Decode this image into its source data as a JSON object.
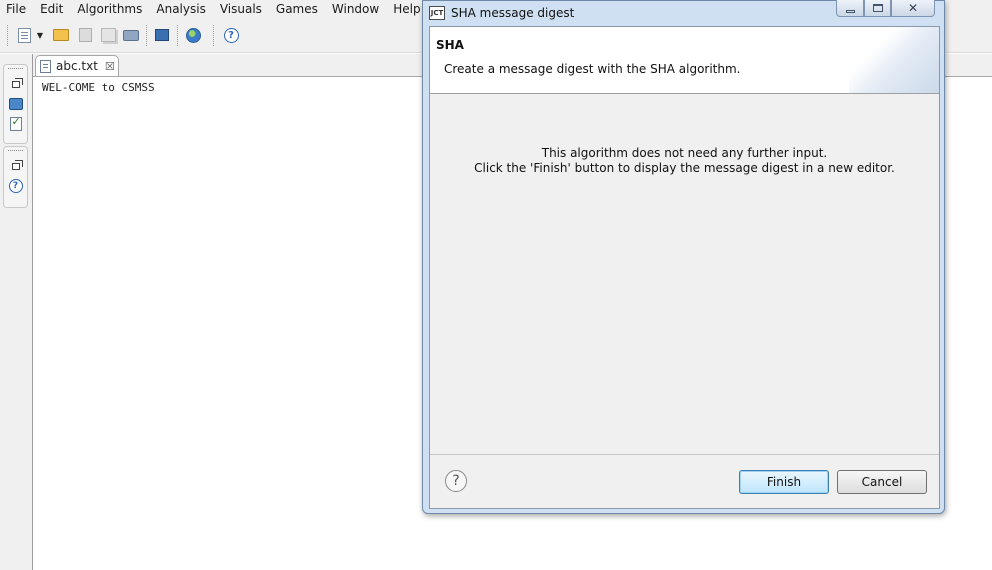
{
  "menubar": {
    "items": [
      "File",
      "Edit",
      "Algorithms",
      "Analysis",
      "Visuals",
      "Games",
      "Window",
      "Help"
    ]
  },
  "toolbar": {
    "icons": [
      "new-document-icon",
      "dropdown-arrow-icon",
      "open-folder-icon",
      "save-icon",
      "save-all-icon",
      "print-icon",
      "monitor-icon",
      "globe-icon",
      "help-icon"
    ]
  },
  "left_trim": {
    "icons": [
      "restore-icon",
      "computer-icon",
      "checklist-icon",
      "restore-icon",
      "help-topic-icon"
    ]
  },
  "editor": {
    "tab_label": "abc.txt",
    "tab_close": "☒",
    "content": "WEL-COME to CSMSS"
  },
  "dialog": {
    "title": "SHA message digest",
    "app_icon_text": "JCT",
    "heading": "SHA",
    "description": "Create a message digest with the SHA algorithm.",
    "message_line1": "This algorithm does not need any further input.",
    "message_line2": "Click the 'Finish' button to display the message digest in a new editor.",
    "help_glyph": "?",
    "finish_label": "Finish",
    "cancel_label": "Cancel",
    "close_glyph": "✕"
  }
}
